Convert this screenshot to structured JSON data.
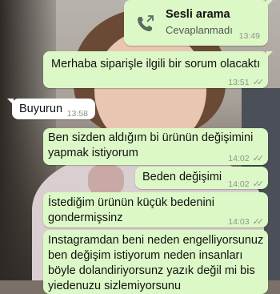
{
  "call": {
    "title": "Sesli arama",
    "status": "Cevaplanmadı",
    "time": "13:49",
    "icon": "phone-icon"
  },
  "messages": [
    {
      "direction": "outgoing",
      "text": "Merhaba siparişle ilgili bir sorum olacaktı",
      "time": "13:51",
      "status": "read"
    },
    {
      "direction": "incoming",
      "text": "Buyurun",
      "time": "13:58"
    },
    {
      "direction": "outgoing",
      "text": "Ben sizden aldığım bi ürünün değişimini yapmak istiyorum",
      "time": "14:02",
      "status": "read"
    },
    {
      "direction": "outgoing",
      "text": "Beden değişimi",
      "time": "14:02",
      "status": "read"
    },
    {
      "direction": "outgoing",
      "text": "İstediğim ürünün küçük bedenini gondermişsinz",
      "time": "14:03",
      "status": "read"
    },
    {
      "direction": "outgoing",
      "text": "Instagramdan beni neden engelliyorsunuz ben değişim istiyorum neden insanları böyle dolandiriyorsunz yazık değil mi bis yiedenuzu sizlemiyorsunu",
      "time": "",
      "status": ""
    }
  ],
  "colors": {
    "outgoing_bubble": "#dcf8c6",
    "incoming_bubble": "#ffffff",
    "timestamp": "#8a958a"
  }
}
